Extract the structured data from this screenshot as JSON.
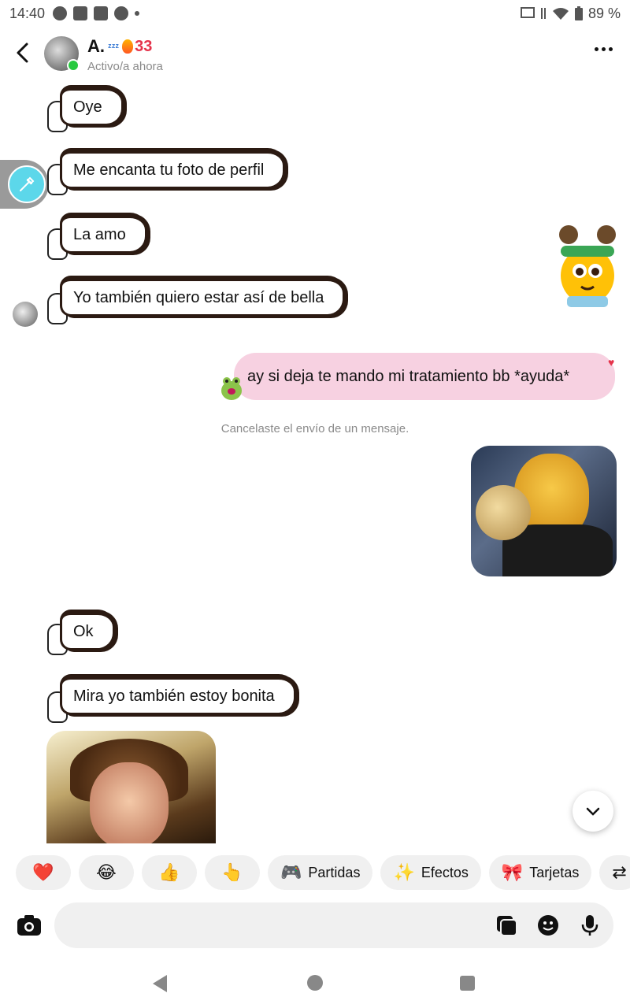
{
  "status_bar": {
    "time": "14:40",
    "battery": "89 %"
  },
  "header": {
    "name": "A.",
    "streak_count": "33",
    "status": "Activo/a ahora"
  },
  "messages": {
    "received": [
      {
        "text": "Oye"
      },
      {
        "text": "Me encanta tu foto de perfil"
      },
      {
        "text": "La amo"
      },
      {
        "text": "Yo también quiero estar así de bella"
      },
      {
        "text": "Ok"
      },
      {
        "text": "Mira yo también estoy bonita"
      }
    ],
    "sent": [
      {
        "text": "ay si deja te mando mi tratamiento bb *ayuda*"
      }
    ],
    "system_note": "Cancelaste el envío de un mensaje."
  },
  "quick_chips": [
    {
      "icon": "heart-icon",
      "glyph": "❤️",
      "label": ""
    },
    {
      "icon": "laugh-icon",
      "glyph": "😂",
      "label": ""
    },
    {
      "icon": "thumbs-up-icon",
      "glyph": "👍",
      "label": ""
    },
    {
      "icon": "point-up-icon",
      "glyph": "👆",
      "label": ""
    },
    {
      "icon": "gamepad-icon",
      "glyph": "🎮",
      "label": "Partidas"
    },
    {
      "icon": "effects-icon",
      "glyph": "✨",
      "label": "Efectos"
    },
    {
      "icon": "cards-icon",
      "glyph": "🎀",
      "label": "Tarjetas"
    }
  ],
  "colors": {
    "sent_bubble": "#f7d1e1",
    "streak": "#e5334b",
    "online": "#27c93f",
    "tool_accent": "#5cd7ea"
  }
}
